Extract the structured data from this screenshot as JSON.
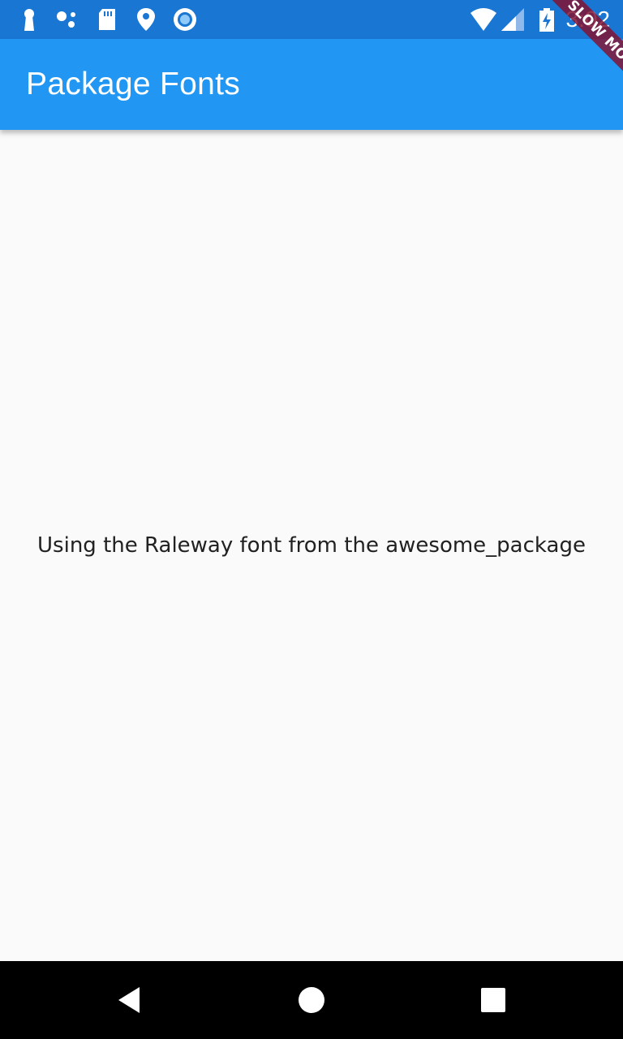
{
  "status_bar": {
    "time": "3:02",
    "left_icons": [
      "keyhole-icon",
      "dots-icon",
      "sd-card-icon",
      "location-pin-icon",
      "record-icon"
    ],
    "right_icons": [
      "wifi-icon",
      "cell-signal-icon",
      "battery-charging-icon"
    ]
  },
  "app_bar": {
    "title": "Package Fonts"
  },
  "body": {
    "text": "Using the Raleway font from the awesome_package"
  },
  "banner": {
    "label": "SLOW MODE"
  },
  "nav_bar": {
    "buttons": [
      "back-icon",
      "home-icon",
      "recents-icon"
    ]
  },
  "colors": {
    "status_bar": "#1976d2",
    "app_bar": "#2196f3",
    "background": "#fafafa",
    "text": "#212121",
    "banner": "#821432"
  }
}
